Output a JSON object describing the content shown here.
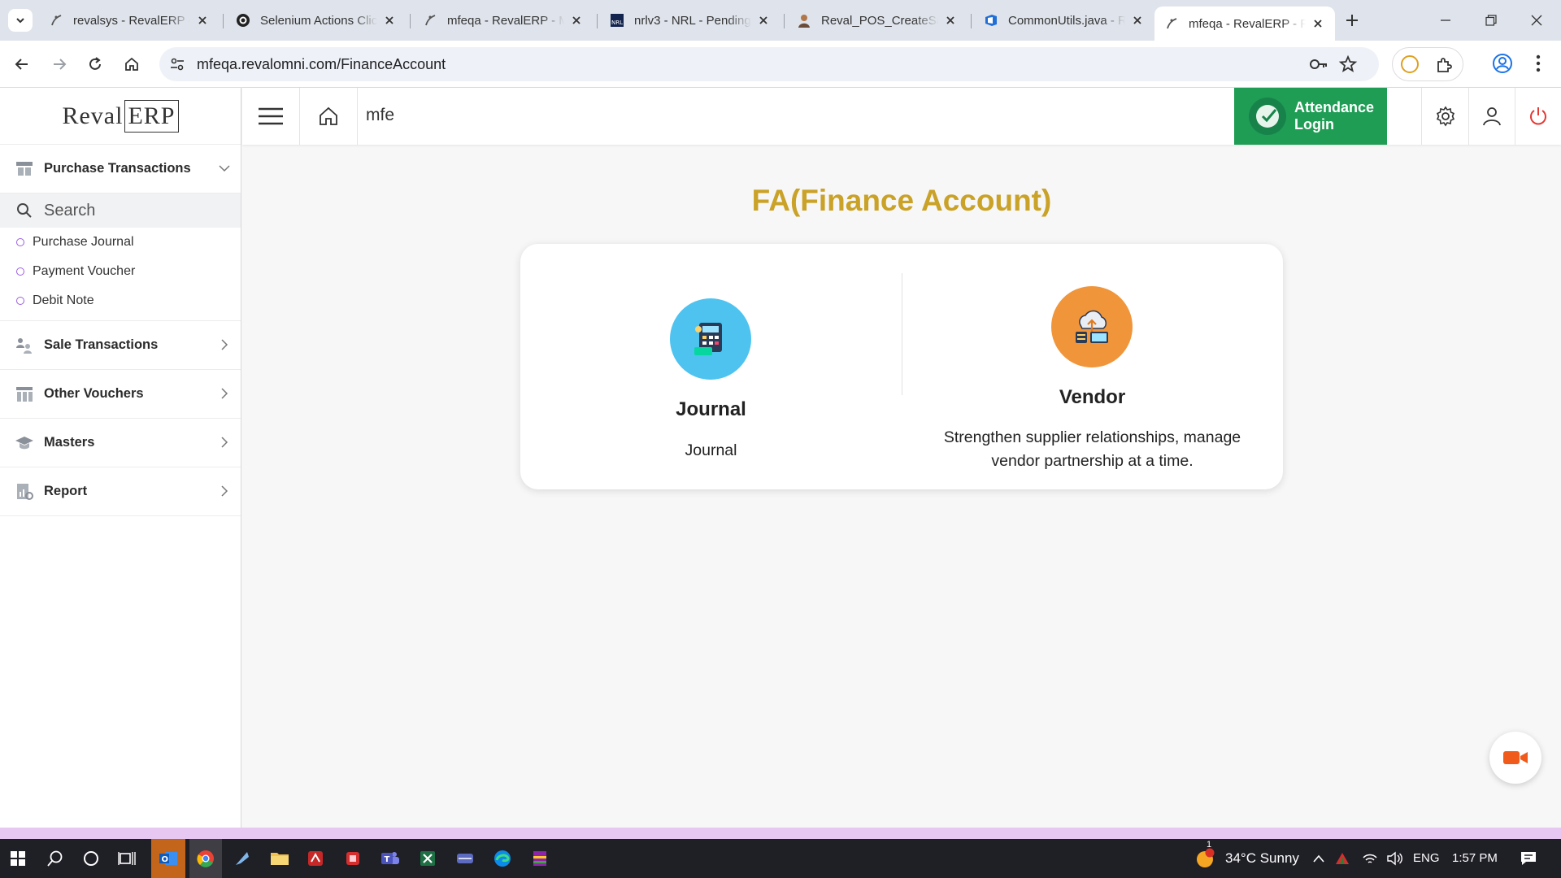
{
  "browser": {
    "tabs": [
      {
        "title": "revalsys - RevalERP - ",
        "active": false
      },
      {
        "title": "Selenium Actions Clic",
        "active": false
      },
      {
        "title": "mfeqa - RevalERP - M",
        "active": false
      },
      {
        "title": "nrlv3 - NRL - Pending",
        "active": false
      },
      {
        "title": "Reval_POS_CreateSal",
        "active": false
      },
      {
        "title": "CommonUtils.java - R",
        "active": false
      },
      {
        "title": "mfeqa - RevalERP - F",
        "active": true
      }
    ],
    "url": "mfeqa.revalomni.com/FinanceAccount"
  },
  "sidebar": {
    "logo_reval": "Reval",
    "logo_erp": "ERP",
    "section_open": "Purchase Transactions",
    "search_placeholder": "Search",
    "sub_items": [
      "Purchase Journal",
      "Payment Voucher",
      "Debit Note"
    ],
    "sections": [
      "Sale Transactions",
      "Other Vouchers",
      "Masters",
      "Report"
    ]
  },
  "header": {
    "text": "mfe",
    "attendance_label": "Attendance Login"
  },
  "main": {
    "title": "FA(Finance Account)",
    "cards": [
      {
        "title": "Journal",
        "description": "Journal"
      },
      {
        "title": "Vendor",
        "description": "Strengthen supplier relationships, manage vendor partnership at a time."
      }
    ]
  },
  "taskbar": {
    "weather": "34°C  Sunny",
    "weather_badge": "1",
    "language": "ENG",
    "time": "1:57 PM"
  },
  "colors": {
    "title_gold": "#c9a227",
    "attendance_green": "#1f9d55",
    "journal_blue": "#4ec3f0",
    "vendor_orange": "#f0953a",
    "sub_dot_purple": "#9b5de5"
  }
}
